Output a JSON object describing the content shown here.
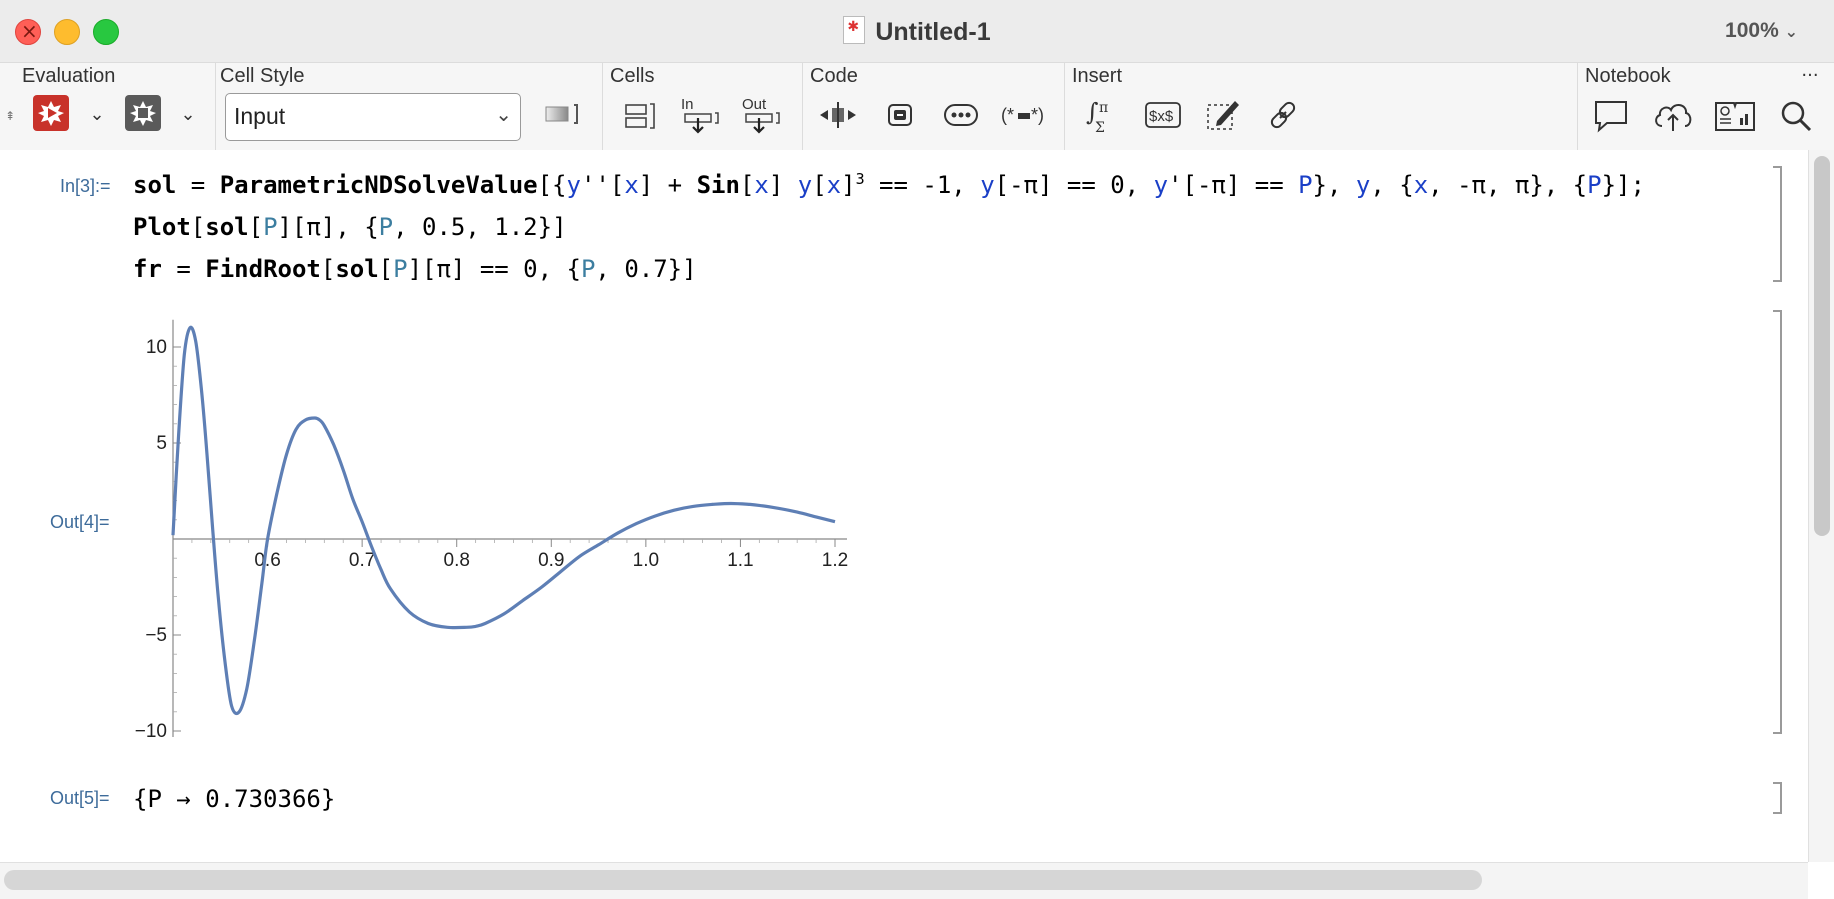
{
  "window": {
    "title": "Untitled-1",
    "zoom": "100%"
  },
  "toolbar": {
    "sections": {
      "evaluation": "Evaluation",
      "cell_style": "Cell Style",
      "cells": "Cells",
      "code": "Code",
      "insert": "Insert",
      "notebook": "Notebook"
    },
    "cell_style_value": "Input",
    "cells_in_label": "In",
    "cells_out_label": "Out",
    "icons": [
      "evaluate-icon",
      "abort-icon",
      "cell-bracket-icon",
      "insert-in-icon",
      "insert-out-icon",
      "code-expand-icon",
      "code-block-icon",
      "ellipsis-icon",
      "comment-code-icon",
      "integral-sum-icon",
      "tex-icon",
      "drawing-icon",
      "hyperlink-icon",
      "comment-icon",
      "cloud-upload-icon",
      "notebook-icon",
      "search-icon"
    ]
  },
  "notebook": {
    "in_label": "In[3]:=",
    "out4_label": "Out[4]=",
    "out5_label": "Out[5]=",
    "code_lines": [
      "sol = ParametricNDSolveValue[{y''[x] + Sin[x] y[x]³ == -1, y[-π] == 0, y'[-π] == P}, y, {x, -π, π}, {P}];",
      "Plot[sol[P][π], {P, 0.5, 1.2}]",
      "fr = FindRoot[sol[P][π] == 0, {P, 0.7}]"
    ],
    "result": "{P → 0.730366}"
  },
  "chart_data": {
    "type": "line",
    "title": "",
    "xlabel": "",
    "ylabel": "",
    "xlim": [
      0.5,
      1.2
    ],
    "ylim": [
      -10,
      11
    ],
    "x_ticks": [
      "0.6",
      "0.7",
      "0.8",
      "0.9",
      "1.0",
      "1.1",
      "1.2"
    ],
    "y_ticks": [
      "10",
      "5",
      "-5",
      "-10"
    ],
    "line_color": "#5e7fb5",
    "series": [
      {
        "x": [
          0.5,
          0.506,
          0.512,
          0.518,
          0.524,
          0.53,
          0.536,
          0.542,
          0.548,
          0.555,
          0.562,
          0.57,
          0.578,
          0.586,
          0.594,
          0.6,
          0.61,
          0.62,
          0.63,
          0.64,
          0.65,
          0.655,
          0.66,
          0.67,
          0.68,
          0.69,
          0.7,
          0.71,
          0.72,
          0.73,
          0.75,
          0.77,
          0.79,
          0.81,
          0.82,
          0.83,
          0.85,
          0.87,
          0.89,
          0.91,
          0.93,
          0.95,
          0.97,
          0.99,
          1.01,
          1.03,
          1.05,
          1.07,
          1.09,
          1.11,
          1.12,
          1.14,
          1.16,
          1.18,
          1.2
        ],
        "y": [
          0.2,
          5.5,
          9.6,
          11.0,
          10.3,
          7.8,
          4.4,
          0.5,
          -3.1,
          -6.4,
          -8.7,
          -9.0,
          -7.8,
          -5.3,
          -2.3,
          0.0,
          2.4,
          4.4,
          5.7,
          6.2,
          6.3,
          6.2,
          5.9,
          4.9,
          3.6,
          2.1,
          0.9,
          -0.4,
          -1.6,
          -2.6,
          -3.8,
          -4.4,
          -4.6,
          -4.6,
          -4.55,
          -4.4,
          -3.9,
          -3.2,
          -2.5,
          -1.7,
          -0.9,
          -0.3,
          0.3,
          0.8,
          1.2,
          1.5,
          1.7,
          1.8,
          1.85,
          1.8,
          1.75,
          1.6,
          1.4,
          1.15,
          0.9
        ]
      }
    ],
    "grid": false
  }
}
